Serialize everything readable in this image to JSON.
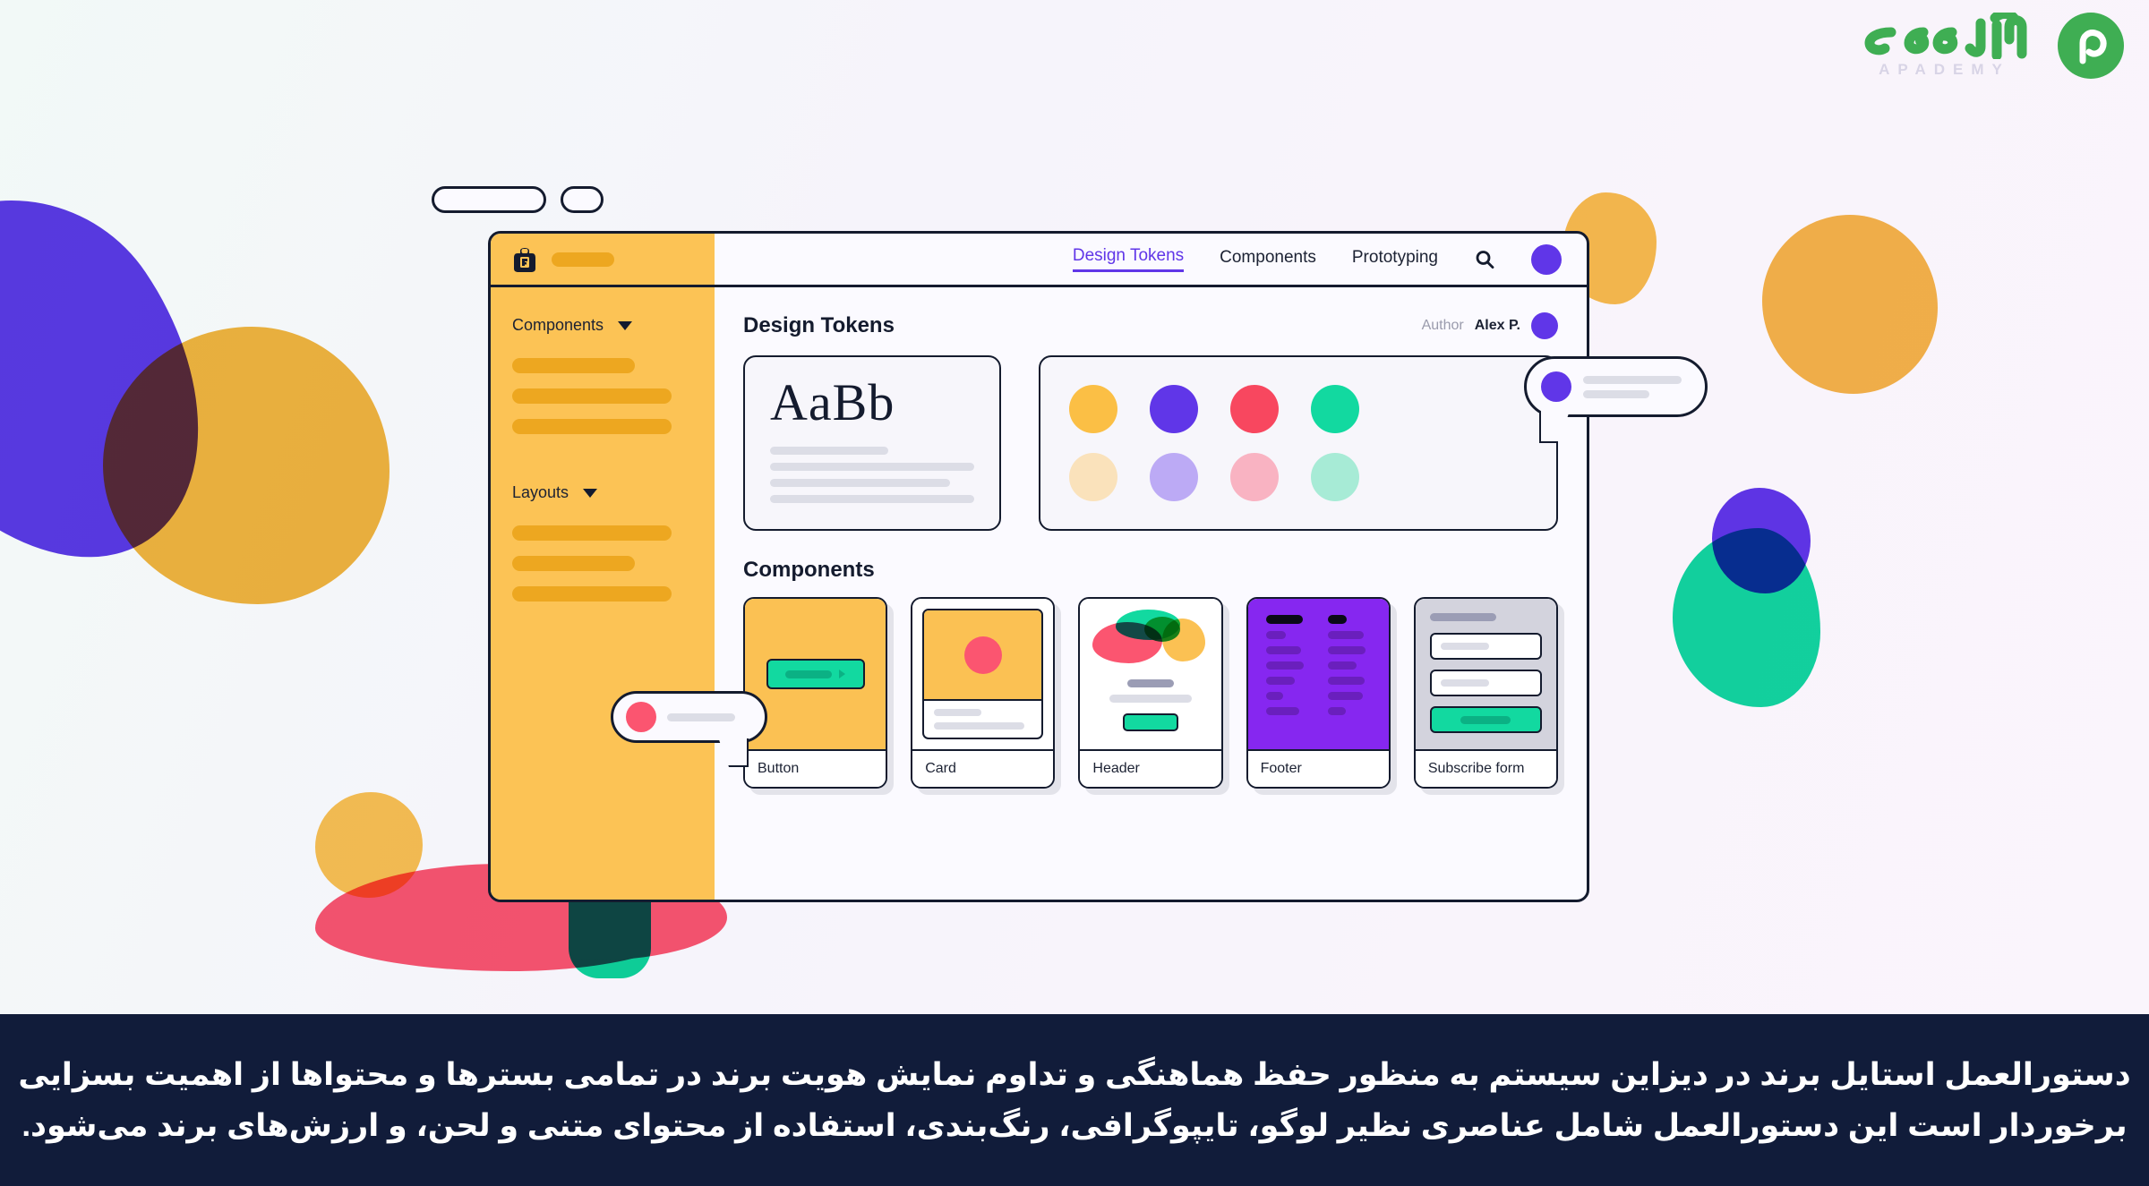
{
  "brand": {
    "logo_text": "آپادمی",
    "logo_subtext": "APADEMY",
    "badge_icon": "apademy-p-badge-icon",
    "green": "#3fae53"
  },
  "window": {
    "tabs": [
      {
        "name": "tab-pill-wide"
      },
      {
        "name": "tab-pill-narrow"
      }
    ],
    "topbar": {
      "logo_icon": "bag-logo-icon",
      "nav": [
        {
          "label": "Design Tokens",
          "active": true
        },
        {
          "label": "Components",
          "active": false
        },
        {
          "label": "Prototyping",
          "active": false
        }
      ],
      "search_icon": "search-icon",
      "avatar": "user-avatar"
    },
    "sidebar": {
      "groups": [
        {
          "label": "Components",
          "items": 3
        },
        {
          "label": "Layouts",
          "items": 3
        }
      ]
    },
    "content": {
      "section_title": "Design Tokens",
      "author_label": "Author",
      "author_name": "Alex P.",
      "typography": {
        "sample": "AaBb",
        "line_widths": [
          "58%",
          "100%",
          "88%",
          "100%"
        ]
      },
      "colors": {
        "row1": [
          "#fbbf45",
          "#6036e8",
          "#f8475f",
          "#12d9a0"
        ],
        "row2": [
          "#fae2bb",
          "#bcaaf5",
          "#f9b3c2",
          "#a7ebd6"
        ]
      },
      "components_title": "Components",
      "components": [
        {
          "label": "Button"
        },
        {
          "label": "Card"
        },
        {
          "label": "Header"
        },
        {
          "label": "Footer"
        },
        {
          "label": "Subscribe form"
        }
      ]
    }
  },
  "bubbles": {
    "left": {
      "dot_color": "pink",
      "lines": 1
    },
    "right": {
      "dot_color": "purple",
      "lines": 2
    }
  },
  "caption": {
    "line1": "دستورالعمل استایل برند در دیزاین سیستم به منظور حفظ هماهنگی و تداوم نمایش هویت برند در تمامی بسترها و محتواها از اهمیت بسزایی",
    "line2": "برخوردار است این دستورالعمل شامل عناصری نظیر لوگو، تایپوگرافی، رنگ‌بندی، استفاده از محتوای متنی و لحن، و ارزش‌های برند می‌شود."
  },
  "theme": {
    "ink": "#141b2e",
    "amber": "#fcc355",
    "purple": "#6036e8",
    "teal": "#12d9a0",
    "pink": "#fb5570",
    "caption_bg": "#111c3a"
  }
}
